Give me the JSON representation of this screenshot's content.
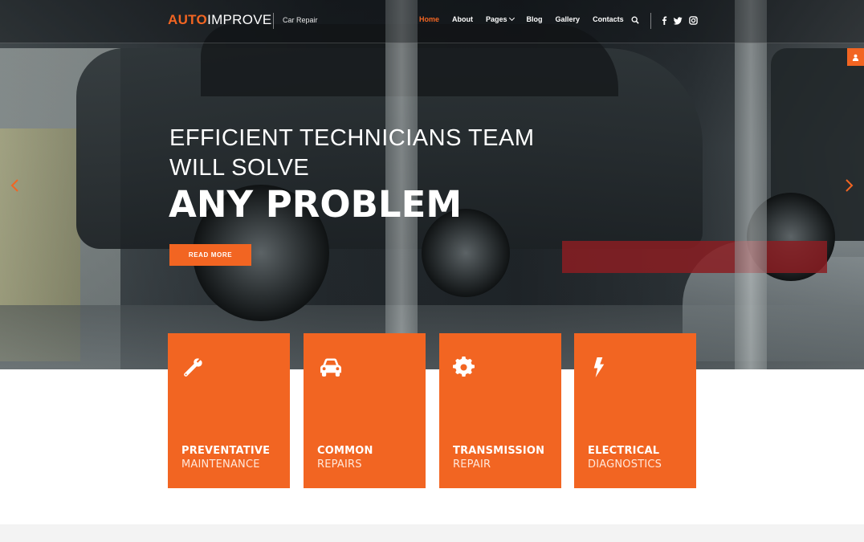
{
  "brand": {
    "accent": "AUTO",
    "rest": "IMPROVE",
    "tagline": "Car Repair",
    "accent_color": "#f26522"
  },
  "nav": {
    "items": [
      {
        "label": "Home",
        "active": true
      },
      {
        "label": "About"
      },
      {
        "label": "Pages",
        "has_dropdown": true
      },
      {
        "label": "Blog"
      },
      {
        "label": "Gallery"
      },
      {
        "label": "Contacts"
      }
    ],
    "icons": [
      "search-icon",
      "facebook-icon",
      "twitter-icon",
      "instagram-icon"
    ]
  },
  "hero": {
    "line1": "EFFICIENT TECHNICIANS TEAM",
    "line2": "WILL SOLVE",
    "strong": "ANY PROBLEM",
    "cta": "READ MORE"
  },
  "services": [
    {
      "icon": "wrench-icon",
      "strong": "PREVENTATIVE",
      "light": "MAINTENANCE"
    },
    {
      "icon": "car-icon",
      "strong": "COMMON",
      "light": "REPAIRS"
    },
    {
      "icon": "gear-icon",
      "strong": "TRANSMISSION",
      "light": "REPAIR"
    },
    {
      "icon": "lightning-icon",
      "strong": "ELECTRICAL",
      "light": "DIAGNOSTICS"
    }
  ],
  "side_tab_icon": "user-icon"
}
